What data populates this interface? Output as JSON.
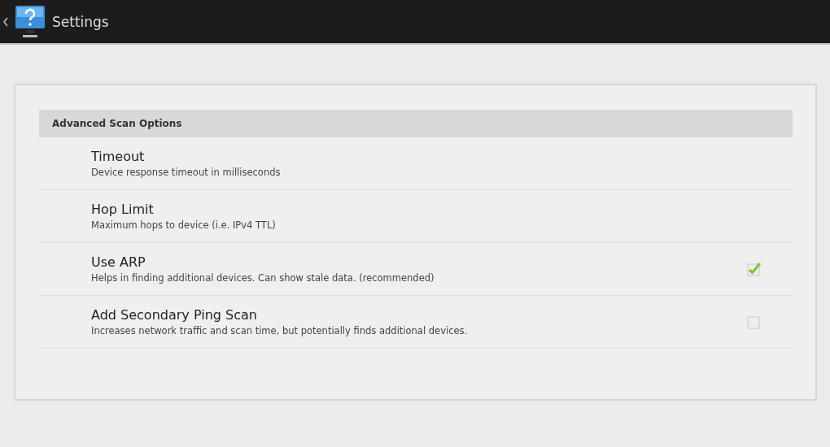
{
  "action_bar": {
    "title": "Settings"
  },
  "section": {
    "title": "Advanced Scan Options"
  },
  "preferences": [
    {
      "kind": "plain",
      "title": "Timeout",
      "summary": "Device response timeout in milliseconds"
    },
    {
      "kind": "plain",
      "title": "Hop Limit",
      "summary": "Maximum hops to device (i.e. IPv4 TTL)"
    },
    {
      "kind": "checkbox",
      "title": "Use ARP",
      "summary": "Helps in finding additional devices. Can show stale data. (recommended)",
      "checked": true
    },
    {
      "kind": "checkbox",
      "title": "Add Secondary Ping Scan",
      "summary": "Increases network traffic and scan time, but potentially finds additional devices.",
      "checked": false
    }
  ]
}
